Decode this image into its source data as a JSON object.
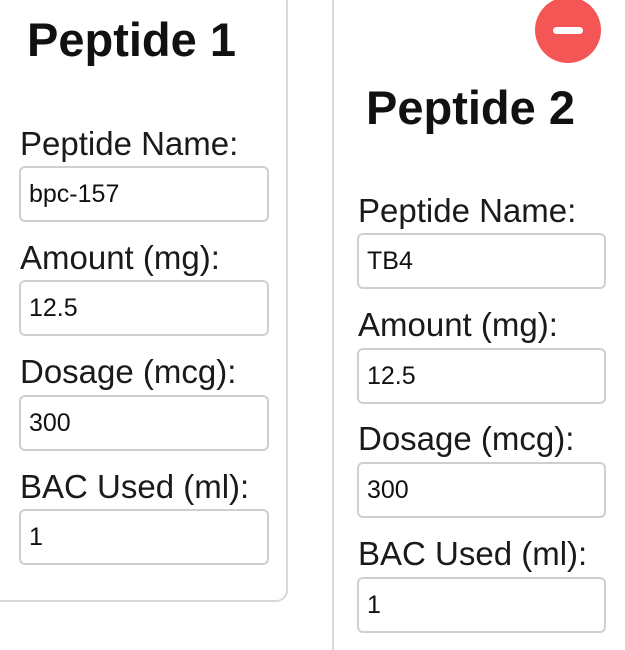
{
  "colors": {
    "remove_button": "#f45656",
    "card_border": "#d8d8d8",
    "input_border": "#cfcfcf",
    "text": "#111111"
  },
  "peptides": [
    {
      "title": "Peptide 1",
      "name_label": "Peptide Name:",
      "name_value": "bpc-157",
      "amount_label": "Amount (mg):",
      "amount_value": "12.5",
      "dosage_label": "Dosage (mcg):",
      "dosage_value": "300",
      "bac_label": "BAC Used (ml):",
      "bac_value": "1"
    },
    {
      "title": "Peptide 2",
      "name_label": "Peptide Name:",
      "name_value": "TB4",
      "amount_label": "Amount (mg):",
      "amount_value": "12.5",
      "dosage_label": "Dosage (mcg):",
      "dosage_value": "300",
      "bac_label": "BAC Used (ml):",
      "bac_value": "1",
      "remove_icon": "minus-circle-icon"
    }
  ]
}
